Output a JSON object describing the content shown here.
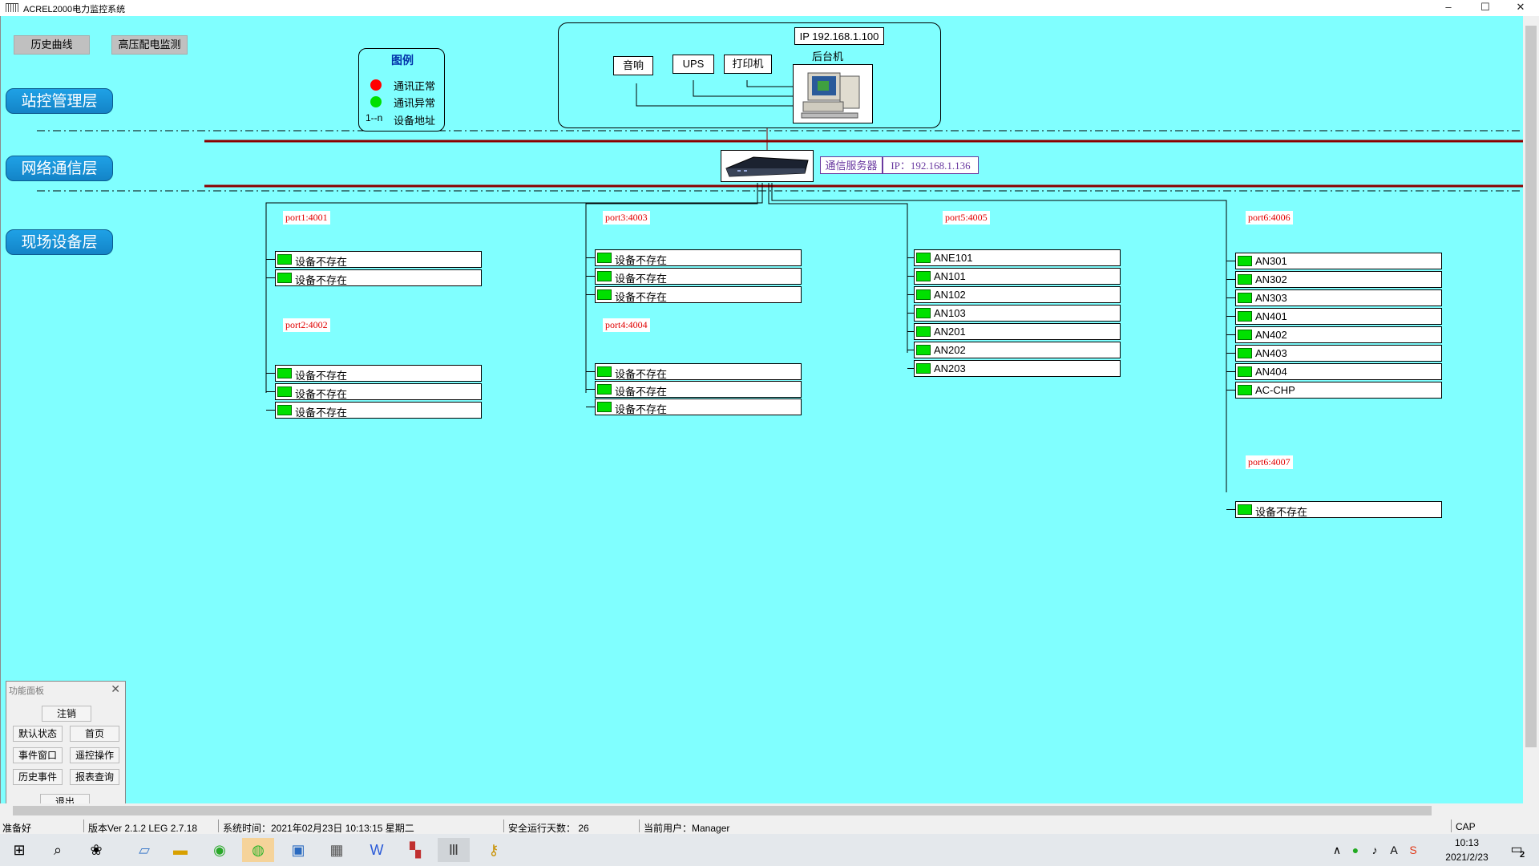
{
  "window": {
    "title": "ACREL2000电力监控系统",
    "min": "–",
    "max": "☐",
    "close": "✕"
  },
  "nav": {
    "history_curve": "历史曲线",
    "hv_monitor": "高压配电监测"
  },
  "layers": {
    "station": "站控管理层",
    "network": "网络通信层",
    "field": "现场设备层"
  },
  "legend": {
    "title": "图例",
    "normal": "通讯正常",
    "abnormal": "通讯异常",
    "addr_key": "1--n",
    "addr_label": "设备地址",
    "normal_color": "#ff0000",
    "abnormal_color": "#00e000"
  },
  "station": {
    "ip": "IP 192.168.1.100",
    "host": "后台机",
    "speaker": "音响",
    "ups": "UPS",
    "printer": "打印机"
  },
  "server": {
    "label": "通信服务器",
    "ip": "IP：192.168.1.136"
  },
  "ports": [
    {
      "label": "port1:4001",
      "devices": [
        "设备不存在",
        "设备不存在"
      ]
    },
    {
      "label": "port2:4002",
      "devices": [
        "设备不存在",
        "设备不存在",
        "设备不存在"
      ]
    },
    {
      "label": "port3:4003",
      "devices": [
        "设备不存在",
        "设备不存在",
        "设备不存在"
      ]
    },
    {
      "label": "port4:4004",
      "devices": [
        "设备不存在",
        "设备不存在",
        "设备不存在"
      ]
    },
    {
      "label": "port5:4005",
      "devices": [
        "ANE101",
        "AN101",
        "AN102",
        "AN103",
        "AN201",
        "AN202",
        "AN203"
      ]
    },
    {
      "label": "port6:4006",
      "devices": [
        "AN301",
        "AN302",
        "AN303",
        "AN401",
        "AN402",
        "AN403",
        "AN404",
        "AC-CHP"
      ]
    },
    {
      "label": "port6:4007",
      "devices": [
        "设备不存在"
      ]
    }
  ],
  "panel": {
    "title": "功能面板",
    "close": "✕",
    "logout": "注销",
    "default_state": "默认状态",
    "home": "首页",
    "event_window": "事件窗口",
    "remote_control": "遥控操作",
    "history_event": "历史事件",
    "report_query": "报表查询",
    "exit": "退出"
  },
  "status": {
    "ready": "准备好",
    "version": "版本Ver 2.1.2 LEG 2.7.18",
    "systime": "系统时间：2021年02月23日  10:13:15  星期二",
    "safe_days": "安全运行天数：  26",
    "user": "当前用户：Manager",
    "cap": "CAP"
  },
  "taskbar": {
    "time": "10:13",
    "date": "2021/2/23",
    "notif": "2"
  }
}
